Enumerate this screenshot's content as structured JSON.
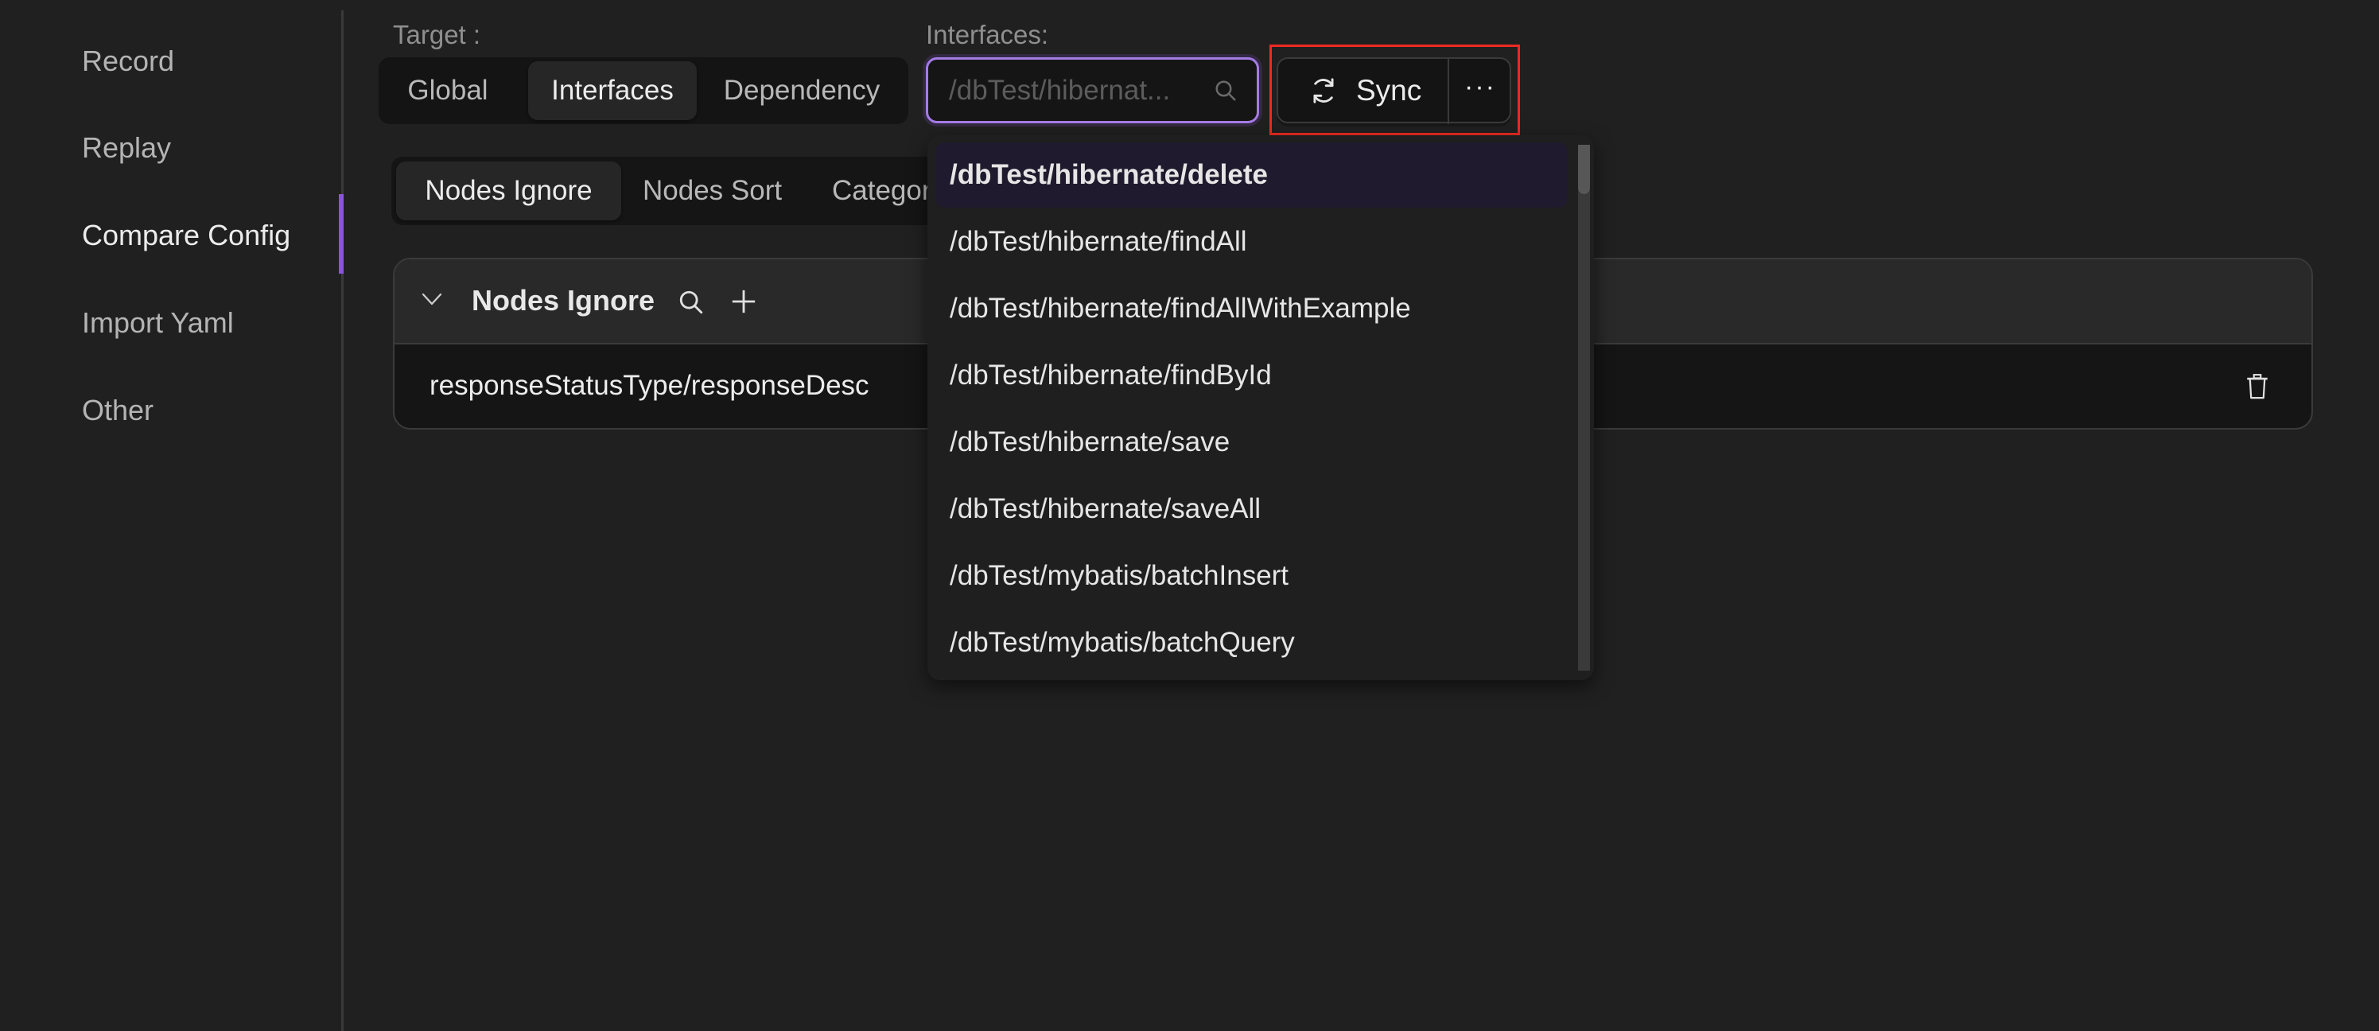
{
  "sidebar": {
    "items": [
      {
        "label": "Record",
        "active": false
      },
      {
        "label": "Replay",
        "active": false
      },
      {
        "label": "Compare Config",
        "active": true
      },
      {
        "label": "Import Yaml",
        "active": false
      },
      {
        "label": "Other",
        "active": false
      }
    ],
    "accent_color": "#8a54dd"
  },
  "target": {
    "label": "Target :",
    "options": [
      "Global",
      "Interfaces",
      "Dependency"
    ],
    "selected": "Interfaces"
  },
  "interfaces": {
    "label": "Interfaces:",
    "value": "",
    "placeholder": "/dbTest/hibernat...",
    "search_icon": "search-icon"
  },
  "sync_group": {
    "sync_label": "Sync",
    "sync_icon": "sync-icon",
    "more_label": "···",
    "highlight_color": "#ee2a22"
  },
  "tabs": {
    "items": [
      "Nodes Ignore",
      "Nodes Sort",
      "Categories"
    ],
    "visible_truncated": "Catego",
    "selected": "Nodes Ignore"
  },
  "card": {
    "title": "Nodes Ignore",
    "rows": [
      {
        "path": "responseStatusType/responseDesc"
      }
    ]
  },
  "dropdown": {
    "items": [
      "/dbTest/hibernate/delete",
      "/dbTest/hibernate/findAll",
      "/dbTest/hibernate/findAllWithExample",
      "/dbTest/hibernate/findById",
      "/dbTest/hibernate/save",
      "/dbTest/hibernate/saveAll",
      "/dbTest/mybatis/batchInsert",
      "/dbTest/mybatis/batchQuery"
    ],
    "active_index": 0
  }
}
